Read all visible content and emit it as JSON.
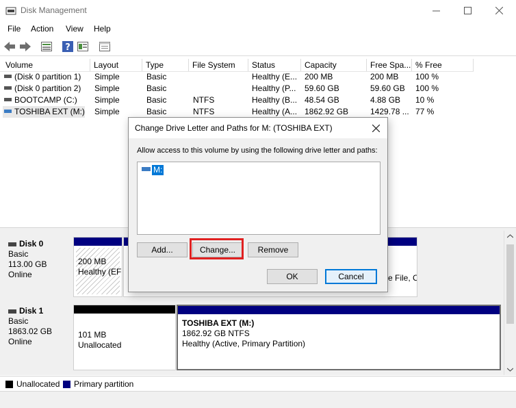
{
  "window": {
    "title": "Disk Management",
    "app_icon": "disk-management-icon",
    "controls": {
      "minimize": "—",
      "maximize": "☐",
      "close": "✕"
    }
  },
  "menu": [
    "File",
    "Action",
    "View",
    "Help"
  ],
  "toolbar": {
    "icons": [
      "back-arrow-icon",
      "forward-arrow-icon",
      "list-view-icon",
      "help-icon",
      "properties-icon",
      "console-icon"
    ]
  },
  "volume_table": {
    "columns": [
      "Volume",
      "Layout",
      "Type",
      "File System",
      "Status",
      "Capacity",
      "Free Spa...",
      "% Free"
    ],
    "rows": [
      {
        "volume": "(Disk 0 partition 1)",
        "layout": "Simple",
        "type": "Basic",
        "fs": "",
        "status": "Healthy (E...",
        "capacity": "200 MB",
        "free": "200 MB",
        "pct": "100 %"
      },
      {
        "volume": "(Disk 0 partition 2)",
        "layout": "Simple",
        "type": "Basic",
        "fs": "",
        "status": "Healthy (P...",
        "capacity": "59.60 GB",
        "free": "59.60 GB",
        "pct": "100 %"
      },
      {
        "volume": "BOOTCAMP (C:)",
        "layout": "Simple",
        "type": "Basic",
        "fs": "NTFS",
        "status": "Healthy (B...",
        "capacity": "48.54 GB",
        "free": "4.88 GB",
        "pct": "10 %"
      },
      {
        "volume": "TOSHIBA EXT (M:)",
        "layout": "Simple",
        "type": "Basic",
        "fs": "NTFS",
        "status": "Healthy (A...",
        "capacity": "1862.92 GB",
        "free": "1429.78 ...",
        "pct": "77 %"
      }
    ]
  },
  "disks": [
    {
      "name": "Disk 0",
      "type": "Basic",
      "size": "113.00 GB",
      "state": "Online",
      "partitions": [
        {
          "line1": "200 MB",
          "line2": "Healthy (EF"
        },
        {
          "line1": "",
          "line2": "e File, C"
        }
      ]
    },
    {
      "name": "Disk 1",
      "type": "Basic",
      "size": "1863.02 GB",
      "state": "Online",
      "partitions": [
        {
          "title": "",
          "line1": "101 MB",
          "line2": "Unallocated"
        },
        {
          "title": "TOSHIBA EXT  (M:)",
          "line1": "1862.92 GB NTFS",
          "line2": "Healthy (Active, Primary Partition)"
        }
      ]
    }
  ],
  "legend": [
    {
      "label": "Unallocated",
      "color": "#000000"
    },
    {
      "label": "Primary partition",
      "color": "#000080"
    }
  ],
  "dialog": {
    "title": "Change Drive Letter and Paths for M: (TOSHIBA EXT)",
    "instruction": "Allow access to this volume by using the following drive letter and paths:",
    "list_items": [
      "M:"
    ],
    "buttons": {
      "add": "Add...",
      "change": "Change...",
      "remove": "Remove",
      "ok": "OK",
      "cancel": "Cancel"
    },
    "close": "✕"
  },
  "colors": {
    "primary_partition": "#000080",
    "unallocated": "#000000",
    "selection": "#0078d7",
    "highlight": "#e02020"
  }
}
